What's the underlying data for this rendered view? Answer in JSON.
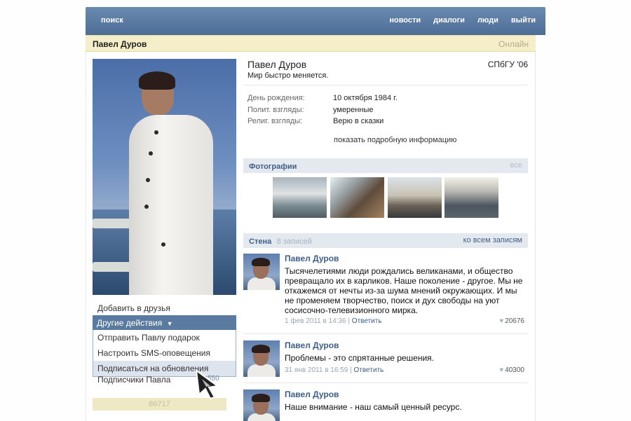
{
  "topbar": {
    "logo": "поиск",
    "nav": [
      "новости",
      "диалоги",
      "люди",
      "выйти"
    ]
  },
  "namebar": {
    "name": "Павел Дуров",
    "status": "Онлайн"
  },
  "profile": {
    "name": "Павел Дуров",
    "university": "СПбГУ '06",
    "status": "Мир быстро меняется.",
    "info": [
      {
        "key": "День рождения:",
        "value": "10 октября 1984 г."
      },
      {
        "key": "Полит. взгляды:",
        "value": "умеренные"
      },
      {
        "key": "Религ. взгляды:",
        "value": "Верю в сказки"
      }
    ],
    "show_more": "показать подробную информацию"
  },
  "left": {
    "add_friend": "Добавить в друзья",
    "other_actions": "Другие действия",
    "menu": [
      "Отправить Павлу подарок",
      "Настроить SMS-оповещения",
      "Подписаться на обновления"
    ],
    "subscribers_label": "Подписчики Павла",
    "subscribers_count": "550",
    "profile_count": "86717"
  },
  "photos": {
    "title": "Фотографии",
    "all": "все"
  },
  "wall": {
    "title": "Стена",
    "count": "8 записей",
    "all_link": "ко всем записям",
    "posts": [
      {
        "author": "Павел Дуров",
        "text": "Тысячелетиями люди рождались великанами, и общество превращало их в карликов. Наше поколение - другое. Мы не откажемся от нечты из-за шума мнений окружающих. И мы не променяем творчество, поиск и дух свободы на уют сосисочно-телевизионного мирка.",
        "date": "1 фев 2011 в 14:36",
        "reply": "Ответить",
        "likes": "20676"
      },
      {
        "author": "Павел Дуров",
        "text": "Проблемы - это спрятанные решения.",
        "date": "31 янв 2011 в 16:59",
        "reply": "Ответить",
        "likes": "40300"
      },
      {
        "author": "Павел Дуров",
        "text": "Наше внимание - наш самый ценный ресурс.",
        "date": "",
        "reply": "",
        "likes": ""
      }
    ]
  },
  "colors": {
    "header": "#4c6d96",
    "link": "#3f5f86",
    "namebar": "#f4efc8"
  }
}
